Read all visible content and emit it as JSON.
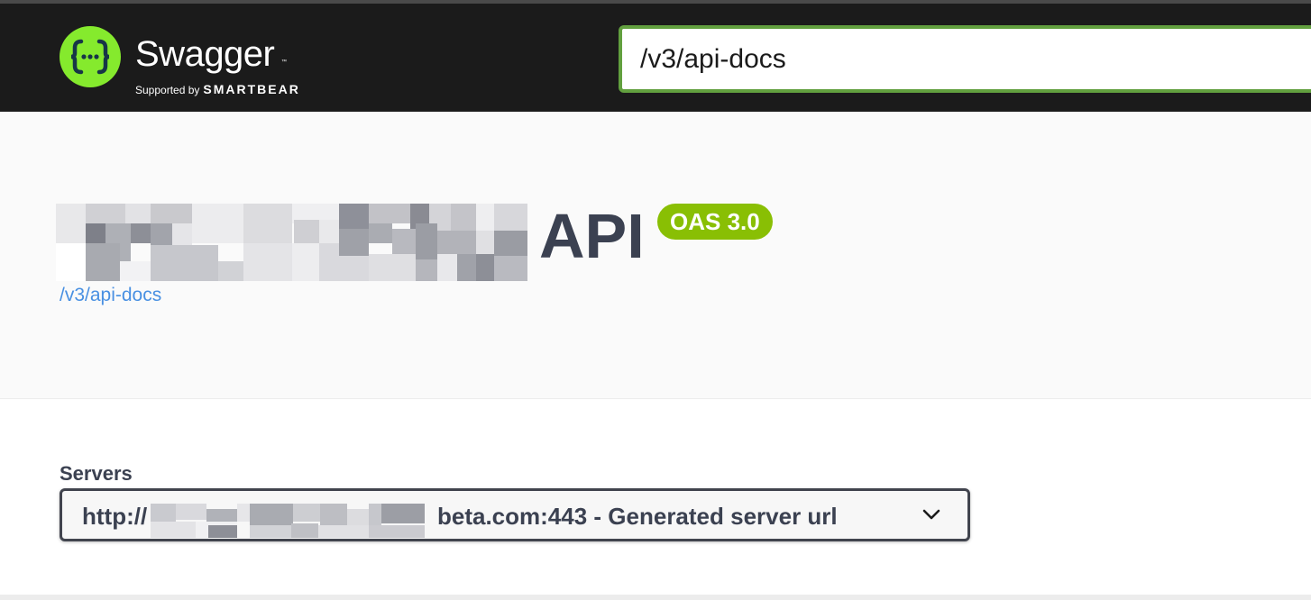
{
  "header": {
    "logo_word": "Swagger",
    "logo_tm": "™",
    "logo_supported_by": "Supported by",
    "logo_brand": "SMARTBEAR",
    "logo_icon": "swagger-braces-icon",
    "url_value": "/v3/api-docs"
  },
  "info": {
    "title_visible": "API",
    "version_badge": "OAS 3.0",
    "spec_link": "/v3/api-docs"
  },
  "servers": {
    "label": "Servers",
    "selected_prefix": "http://",
    "selected_suffix": "beta.com:443 - Generated server url",
    "dropdown_icon": "chevron-down-icon"
  },
  "colors": {
    "topbar_bg": "#1b1b1b",
    "brand_green": "#85ea2d",
    "input_border": "#62a03f",
    "badge_green": "#89bf04",
    "title_text": "#3b4151",
    "link_blue": "#4990e2"
  }
}
